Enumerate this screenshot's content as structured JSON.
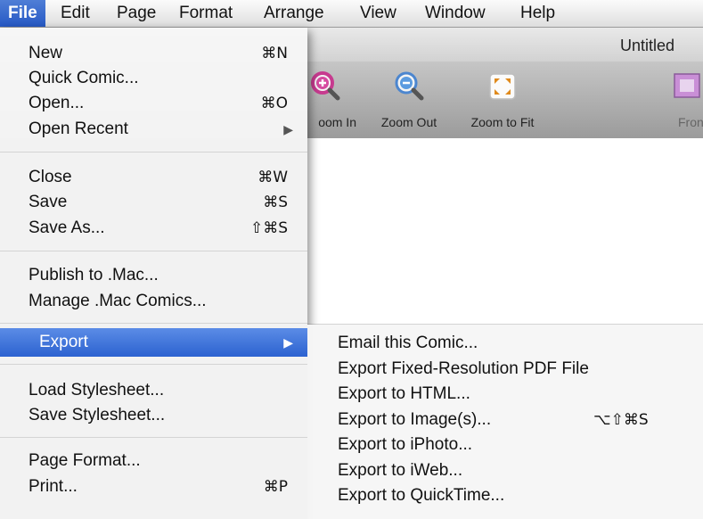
{
  "menubar": {
    "items": [
      {
        "label": "File",
        "active": true
      },
      {
        "label": "Edit"
      },
      {
        "label": "Page"
      },
      {
        "label": "Format"
      },
      {
        "label": "Arrange"
      },
      {
        "label": "View"
      },
      {
        "label": "Window"
      },
      {
        "label": "Help"
      }
    ]
  },
  "window": {
    "title": "Untitled",
    "toolbar": [
      {
        "label": "oom In",
        "icon": "zoom-in-icon"
      },
      {
        "label": "Zoom Out",
        "icon": "zoom-out-icon"
      },
      {
        "label": "Zoom to Fit",
        "icon": "zoom-to-fit-icon"
      },
      {
        "label": "Fron",
        "icon": "bring-to-front-icon"
      }
    ]
  },
  "file_menu": {
    "items": [
      {
        "label": "New",
        "shortcut": "⌘N"
      },
      {
        "label": "Quick Comic...",
        "shortcut": ""
      },
      {
        "label": "Open...",
        "shortcut": "⌘O"
      },
      {
        "label": "Open Recent",
        "submenu_arrow": "▶"
      },
      {
        "label": "Close",
        "shortcut": "⌘W"
      },
      {
        "label": "Save",
        "shortcut": "⌘S"
      },
      {
        "label": "Save As...",
        "shortcut": "⇧⌘S"
      },
      {
        "label": "Publish to .Mac...",
        "shortcut": ""
      },
      {
        "label": "Manage .Mac Comics...",
        "shortcut": ""
      },
      {
        "label": "Export",
        "submenu_arrow": "▶",
        "highlighted": true
      },
      {
        "label": "Load Stylesheet...",
        "shortcut": ""
      },
      {
        "label": "Save Stylesheet...",
        "shortcut": ""
      },
      {
        "label": "Page Format...",
        "shortcut": ""
      },
      {
        "label": "Print...",
        "shortcut": "⌘P"
      }
    ]
  },
  "export_submenu": {
    "items": [
      {
        "label": "Email this Comic...",
        "shortcut": ""
      },
      {
        "label": "Export Fixed-Resolution PDF File",
        "shortcut": ""
      },
      {
        "label": "Export to HTML...",
        "shortcut": ""
      },
      {
        "label": "Export to Image(s)...",
        "shortcut": "⌥⇧⌘S"
      },
      {
        "label": "Export to iPhoto...",
        "shortcut": ""
      },
      {
        "label": "Export to iWeb...",
        "shortcut": ""
      },
      {
        "label": "Export to QuickTime...",
        "shortcut": ""
      }
    ]
  },
  "colors": {
    "menu_highlight": "#2c62d0",
    "menu_background": "#f6f6f6",
    "toolbar_background": "#a8a8a8"
  }
}
